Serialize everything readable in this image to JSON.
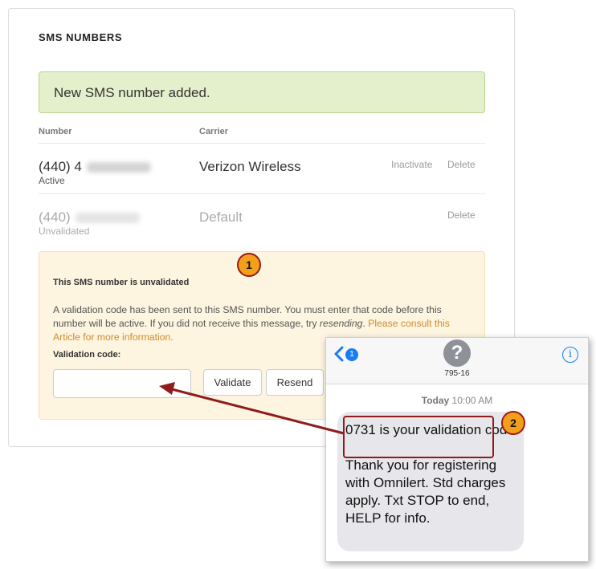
{
  "panel": {
    "title": "SMS NUMBERS",
    "success_message": "New SMS number added.",
    "columns": {
      "number": "Number",
      "carrier": "Carrier"
    },
    "rows": [
      {
        "prefix": "(440)",
        "suffix": "4",
        "status": "Active",
        "carrier": "Verizon Wireless",
        "actions": [
          "Inactivate",
          "Delete"
        ]
      },
      {
        "prefix": "(440)",
        "status": "Unvalidated",
        "carrier": "Default",
        "actions": [
          "Delete"
        ]
      }
    ],
    "warning": {
      "title": "This SMS number is unvalidated",
      "text_before": "A validation code has been sent to this SMS number. You must enter that code before this number will be active. If you did not receive this message, try ",
      "resending": "resending",
      "text_after": ". ",
      "link": "Please consult this Article for more information.",
      "label": "Validation code:",
      "input_value": "",
      "validate_label": "Validate",
      "resend_label": "Resend"
    }
  },
  "callouts": [
    "1",
    "2"
  ],
  "phone": {
    "back_badge": "1",
    "avatar_glyph": "?",
    "contact": "795-16",
    "info_glyph": "i",
    "time_day": "Today",
    "time_clock": "10:00 AM",
    "message": "0731 is your validation code.\n\nThank you for registering with Omnilert. Std charges apply. Txt STOP to end, HELP for info."
  },
  "colors": {
    "success_bg": "#e4efcc",
    "warning_bg": "#fdf5e0",
    "link": "#d18b2c",
    "callout": "#f2a01c",
    "annotation": "#8f1c1c",
    "ios_blue": "#1a7cf5"
  }
}
